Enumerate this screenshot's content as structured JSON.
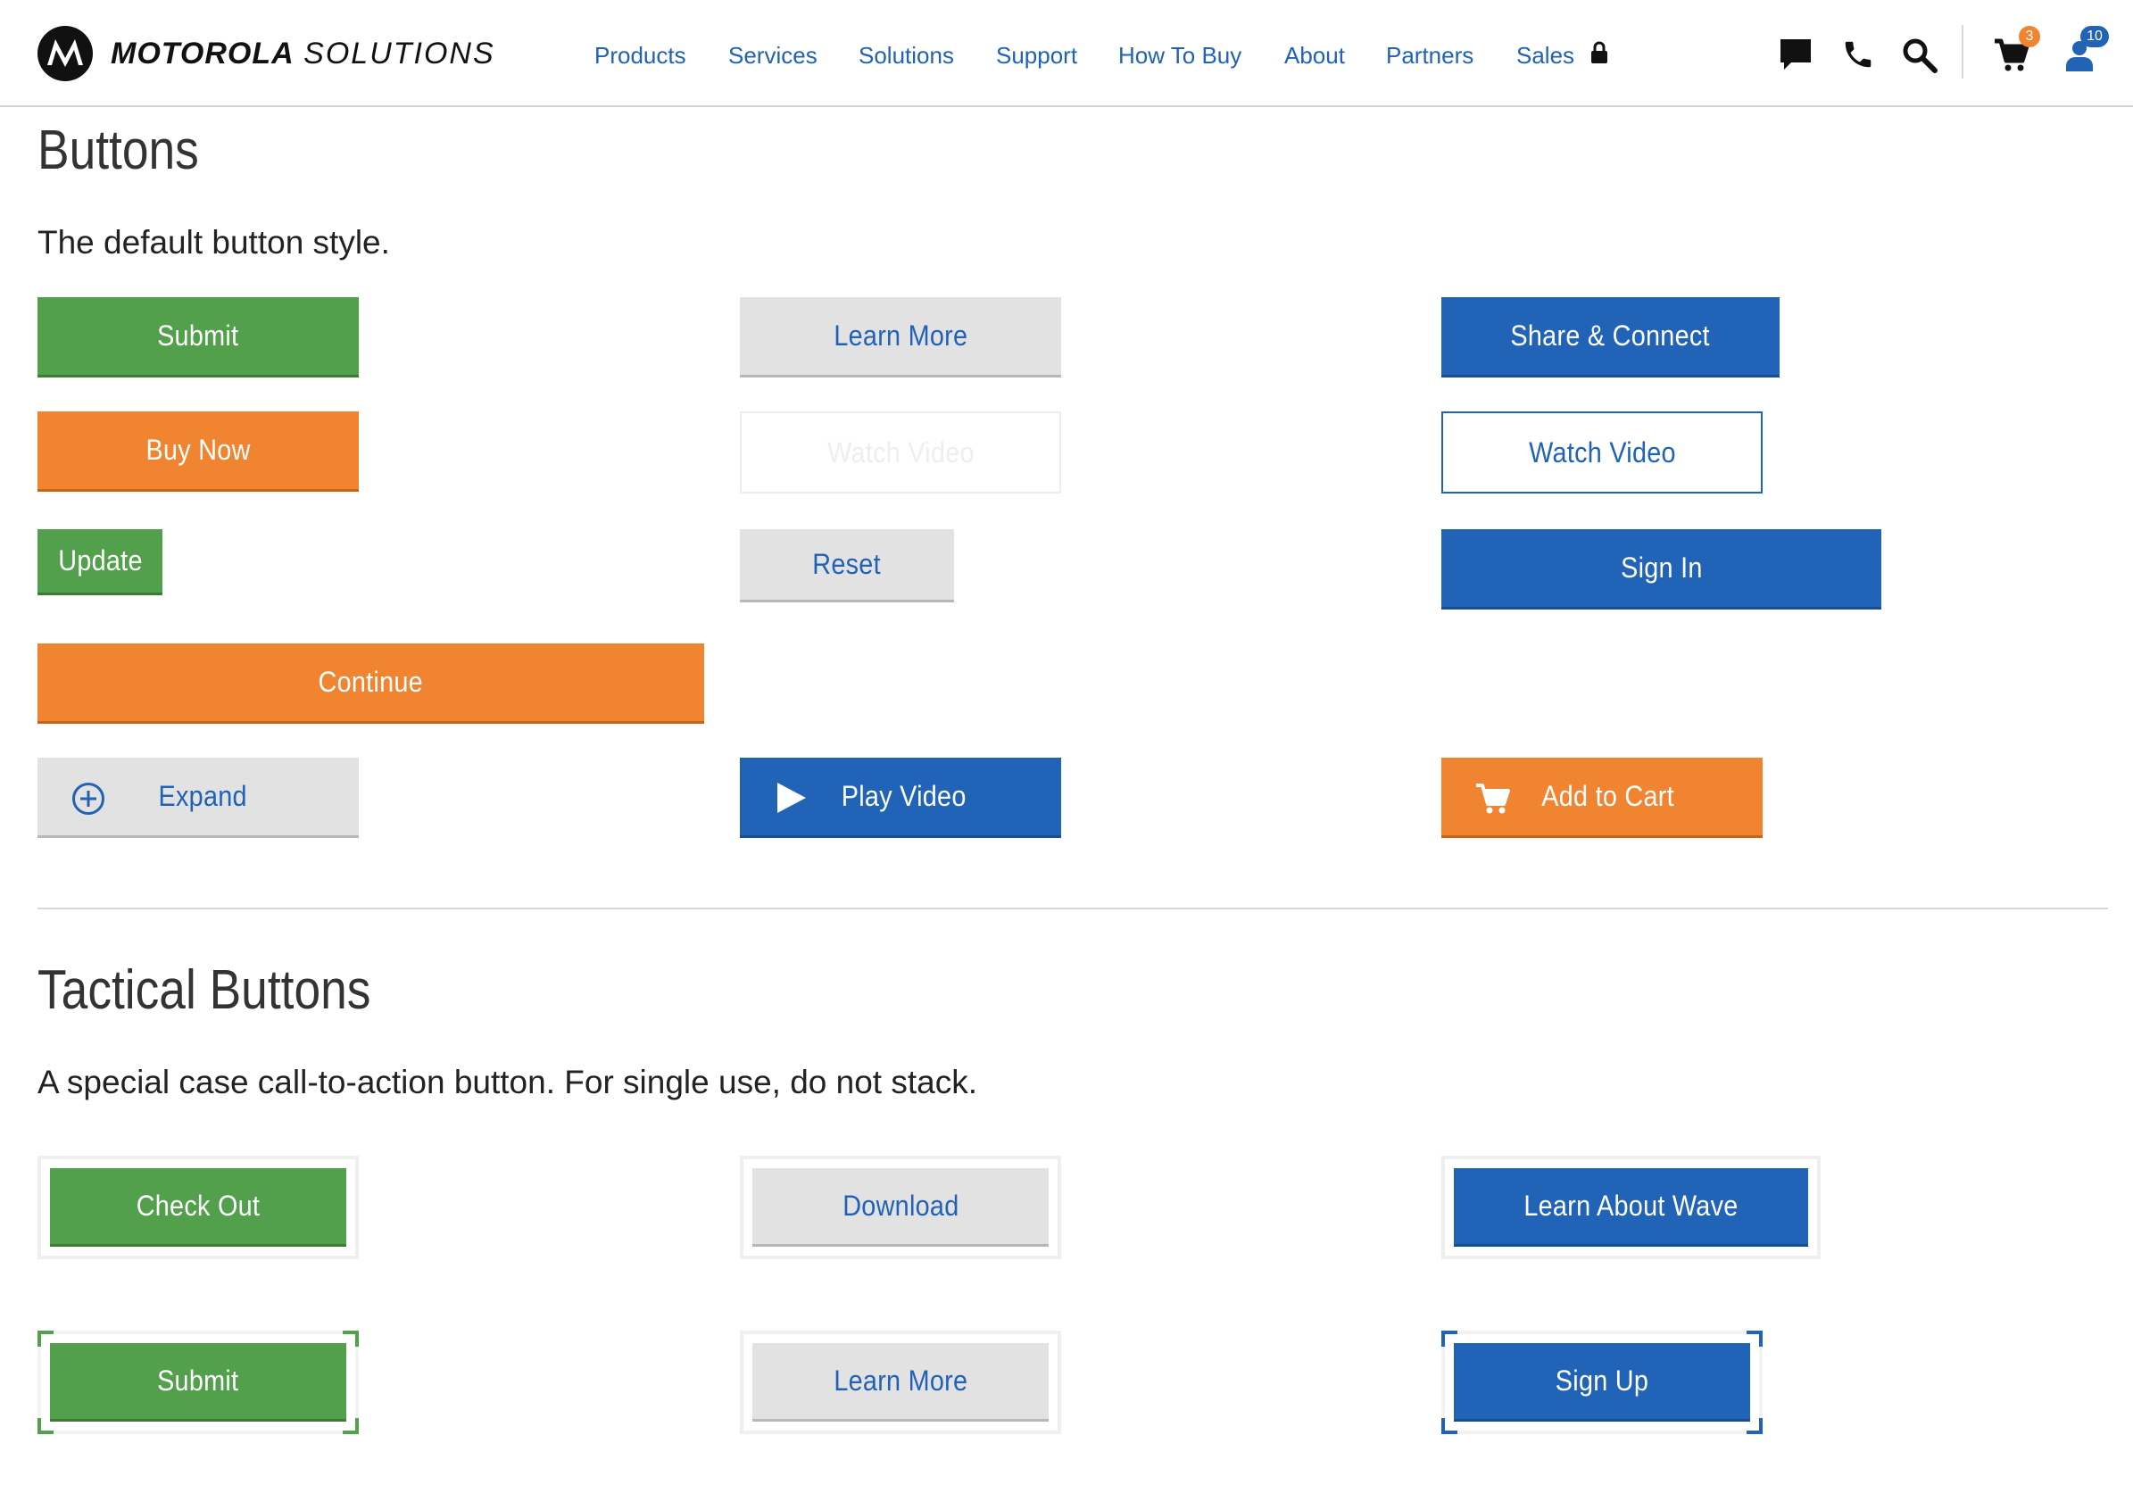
{
  "brand": {
    "name": "MOTOROLA",
    "name_suffix": "SOLUTIONS"
  },
  "nav": {
    "items": [
      {
        "label": "Products"
      },
      {
        "label": "Services"
      },
      {
        "label": "Solutions"
      },
      {
        "label": "Support"
      },
      {
        "label": "How To Buy"
      },
      {
        "label": "About"
      },
      {
        "label": "Partners"
      },
      {
        "label": "Sales"
      }
    ]
  },
  "header_icons": {
    "chat": "chat-bubble-icon",
    "phone": "phone-icon",
    "search": "search-icon",
    "cart": "cart-icon",
    "cart_count": "3",
    "account": "user-icon",
    "account_count": "10"
  },
  "colors": {
    "link_blue": "#2062b6",
    "green": "#52a04c",
    "orange": "#f08431",
    "blue": "#2163b6",
    "grey": "#e2e2e2"
  },
  "buttons_section": {
    "title": "Buttons",
    "description": "The default button style.",
    "buttons": {
      "submit": "Submit",
      "learn_more": "Learn More",
      "share_connect": "Share & Connect",
      "buy_now": "Buy Now",
      "watch_video_disabled": "Watch Video",
      "watch_video": "Watch Video",
      "update": "Update",
      "reset": "Reset",
      "sign_in": "Sign In",
      "continue": "Continue",
      "expand": "Expand",
      "play_video": "Play Video",
      "add_to_cart": "Add to Cart"
    }
  },
  "tactical_section": {
    "title": "Tactical Buttons",
    "description": "A special case call-to-action button. For single use, do not stack.",
    "buttons": {
      "check_out": "Check Out",
      "download": "Download",
      "learn_about_wave": "Learn About Wave",
      "submit": "Submit",
      "learn_more": "Learn More",
      "sign_up": "Sign Up"
    }
  }
}
